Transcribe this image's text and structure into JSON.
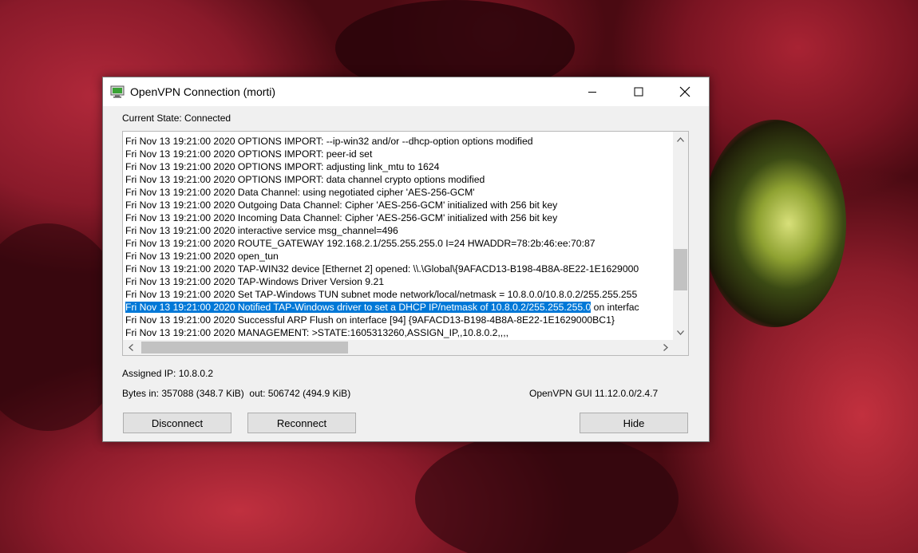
{
  "window": {
    "title": "OpenVPN Connection (morti)"
  },
  "status": {
    "current_state": "Current State: Connected"
  },
  "log": {
    "lines": [
      "Fri Nov 13 19:21:00 2020 OPTIONS IMPORT: --ip-win32 and/or --dhcp-option options modified",
      "Fri Nov 13 19:21:00 2020 OPTIONS IMPORT: peer-id set",
      "Fri Nov 13 19:21:00 2020 OPTIONS IMPORT: adjusting link_mtu to 1624",
      "Fri Nov 13 19:21:00 2020 OPTIONS IMPORT: data channel crypto options modified",
      "Fri Nov 13 19:21:00 2020 Data Channel: using negotiated cipher 'AES-256-GCM'",
      "Fri Nov 13 19:21:00 2020 Outgoing Data Channel: Cipher 'AES-256-GCM' initialized with 256 bit key",
      "Fri Nov 13 19:21:00 2020 Incoming Data Channel: Cipher 'AES-256-GCM' initialized with 256 bit key",
      "Fri Nov 13 19:21:00 2020 interactive service msg_channel=496",
      "Fri Nov 13 19:21:00 2020 ROUTE_GATEWAY 192.168.2.1/255.255.255.0 I=24 HWADDR=78:2b:46:ee:70:87",
      "Fri Nov 13 19:21:00 2020 open_tun",
      "Fri Nov 13 19:21:00 2020 TAP-WIN32 device [Ethernet 2] opened: \\\\.\\Global\\{9AFACD13-B198-4B8A-8E22-1E1629000",
      "Fri Nov 13 19:21:00 2020 TAP-Windows Driver Version 9.21",
      "Fri Nov 13 19:21:00 2020 Set TAP-Windows TUN subnet mode network/local/netmask = 10.8.0.0/10.8.0.2/255.255.255",
      "Fri Nov 13 19:21:00 2020 Successful ARP Flush on interface [94] {9AFACD13-B198-4B8A-8E22-1E1629000BC1}",
      "Fri Nov 13 19:21:00 2020 MANAGEMENT: >STATE:1605313260,ASSIGN_IP,,10.8.0.2,,,,"
    ],
    "selected_line": {
      "selected_text": "Fri Nov 13 19:21:00 2020 Notified TAP-Windows driver to set a DHCP IP/netmask of 10.8.0.2/255.255.255.0",
      "rest_text": " on interfac"
    }
  },
  "info": {
    "assigned_ip": "Assigned IP: 10.8.0.2",
    "bytes": "Bytes in: 357088 (348.7 KiB)  out: 506742 (494.9 KiB)",
    "version": "OpenVPN GUI 11.12.0.0/2.4.7"
  },
  "buttons": {
    "disconnect": "Disconnect",
    "reconnect": "Reconnect",
    "hide": "Hide"
  },
  "scrollbars": {
    "vertical_position": 0.8,
    "horizontal_position": 0.0
  },
  "colors": {
    "selection": "#0078d7",
    "window_bg": "#f0f0f0"
  }
}
